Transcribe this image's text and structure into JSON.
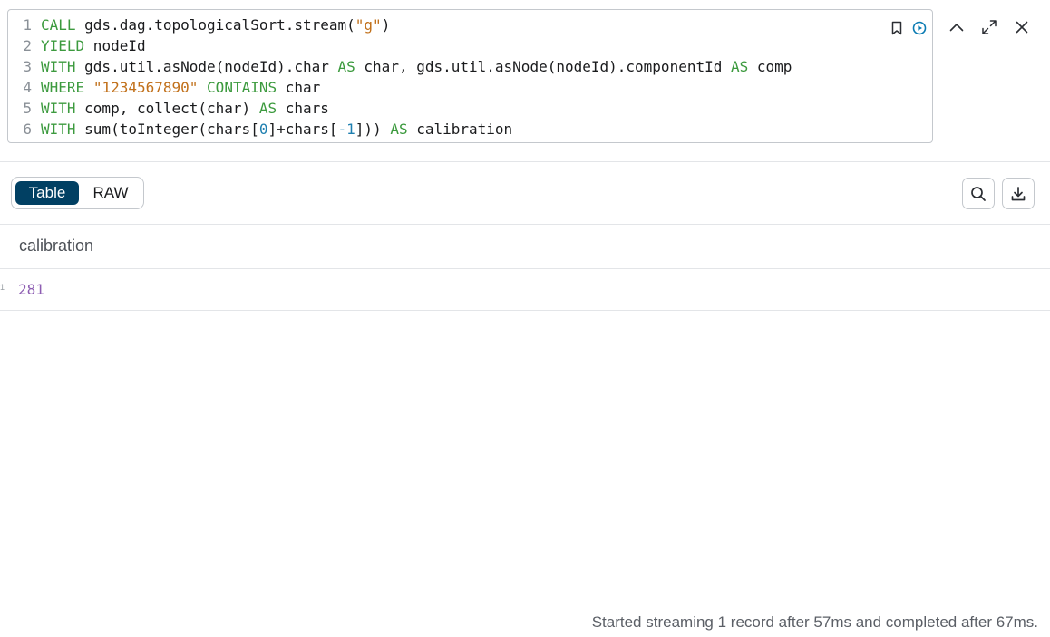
{
  "editor": {
    "lines": [
      {
        "n": "1",
        "tokens": [
          [
            "kw",
            "CALL"
          ],
          [
            "plain",
            " gds.dag.topologicalSort.stream("
          ],
          [
            "str",
            "\"g\""
          ],
          [
            "plain",
            ")"
          ]
        ]
      },
      {
        "n": "2",
        "tokens": [
          [
            "kw",
            "YIELD"
          ],
          [
            "plain",
            " nodeId"
          ]
        ]
      },
      {
        "n": "3",
        "tokens": [
          [
            "kw",
            "WITH"
          ],
          [
            "plain",
            " gds.util.asNode(nodeId).char "
          ],
          [
            "kw",
            "AS"
          ],
          [
            "plain",
            " char, gds.util.asNode(nodeId).componentId "
          ],
          [
            "kw",
            "AS"
          ],
          [
            "plain",
            " comp"
          ]
        ]
      },
      {
        "n": "4",
        "tokens": [
          [
            "kw",
            "WHERE"
          ],
          [
            "plain",
            " "
          ],
          [
            "str",
            "\"1234567890\""
          ],
          [
            "plain",
            " "
          ],
          [
            "kw",
            "CONTAINS"
          ],
          [
            "plain",
            " char"
          ]
        ]
      },
      {
        "n": "5",
        "tokens": [
          [
            "kw",
            "WITH"
          ],
          [
            "plain",
            " comp, collect(char) "
          ],
          [
            "kw",
            "AS"
          ],
          [
            "plain",
            " chars"
          ]
        ]
      },
      {
        "n": "6",
        "tokens": [
          [
            "kw",
            "WITH"
          ],
          [
            "plain",
            " sum(toInteger(chars["
          ],
          [
            "num",
            "0"
          ],
          [
            "plain",
            "]+chars["
          ],
          [
            "num",
            "-1"
          ],
          [
            "plain",
            "])) "
          ],
          [
            "kw",
            "AS"
          ],
          [
            "plain",
            " calibration"
          ]
        ]
      }
    ],
    "icons": [
      "bookmark-icon",
      "run-icon"
    ]
  },
  "frame_controls": [
    "collapse-icon",
    "expand-icon",
    "close-icon"
  ],
  "view_toggle": {
    "table_label": "Table",
    "raw_label": "RAW",
    "selected": "Table"
  },
  "toolbar_icons": [
    "search-icon",
    "download-icon"
  ],
  "result": {
    "columns": [
      "calibration"
    ],
    "row_index": "1",
    "rows": [
      [
        "281"
      ]
    ]
  },
  "status": "Started streaming 1 record after 57ms and completed after 67ms.",
  "colors": {
    "keyword": "#3c9a3e",
    "string": "#c1701a",
    "number": "#1e7fb0",
    "toggle_active_bg": "#014063",
    "value": "#8d5db2",
    "run_icon": "#0a7bb3"
  }
}
